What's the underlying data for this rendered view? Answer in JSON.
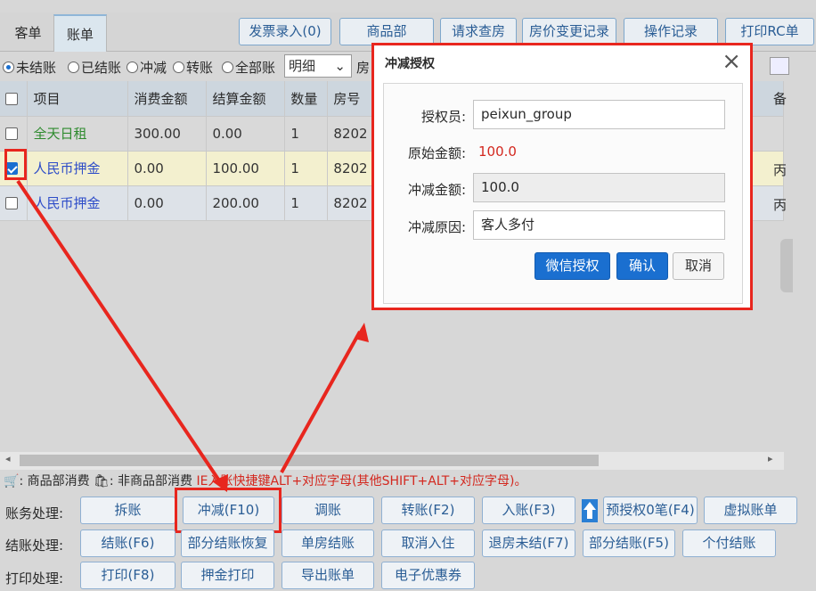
{
  "tabs": [
    {
      "label": "客单"
    },
    {
      "label": "账单"
    }
  ],
  "toolbar": {
    "invoice": "发票录入(0)",
    "goods_dept": "商品部",
    "request_room": "请求查房",
    "price_change": "房价变更记录",
    "op_log": "操作记录",
    "print_rc": "打印RC单"
  },
  "filter": {
    "radios": [
      "未结账",
      "已结账",
      "冲减",
      "转账",
      "全部账"
    ],
    "detail_select": "明细",
    "room_label": "房"
  },
  "table": {
    "headers": [
      "项目",
      "消费金额",
      "结算金额",
      "数量",
      "房号",
      "备"
    ],
    "rows": [
      {
        "item": "全天日租",
        "consume": "300.00",
        "settle": "0.00",
        "qty": "1",
        "room": "8202",
        "extra": ""
      },
      {
        "item": "人民币押金",
        "consume": "0.00",
        "settle": "100.00",
        "qty": "1",
        "room": "8202",
        "extra": "丙"
      },
      {
        "item": "人民币押金",
        "consume": "0.00",
        "settle": "200.00",
        "qty": "1",
        "room": "8202",
        "extra": "丙"
      }
    ]
  },
  "legend": {
    "goods": "商品部消费",
    "non_goods": "非商品部消费",
    "hint": "IE入账快捷键ALT+对应字母(其他SHIFT+ALT+对应字母)。"
  },
  "actions": {
    "account_label": "账务处理:",
    "settle_label": "结账处理:",
    "print_label": "打印处理:",
    "split": "拆账",
    "offset": "冲减(F10)",
    "adjust": "调账",
    "transfer": "转账(F2)",
    "post": "入账(F3)",
    "preauth": "预授权0笔(F4)",
    "virtual": "虚拟账单",
    "checkout": "结账(F6)",
    "partial_restore": "部分结账恢复",
    "single_room": "单房结账",
    "cancel_checkin": "取消入住",
    "checkout_unpaid": "退房未结(F7)",
    "partial_checkout": "部分结账(F5)",
    "individual": "个付结账",
    "print": "打印(F8)",
    "deposit_print": "押金打印",
    "export": "导出账单",
    "coupon": "电子优惠券"
  },
  "dialog": {
    "title": "冲减授权",
    "authorizer_label": "授权员:",
    "authorizer_value": "peixun_group",
    "original_label": "原始金额:",
    "original_value": "100.0",
    "offset_label": "冲减金额:",
    "offset_value": "100.0",
    "reason_label": "冲减原因:",
    "reason_value": "客人多付",
    "wechat_btn": "微信授权",
    "confirm_btn": "确认",
    "cancel_btn": "取消",
    "accent": "#1a6fd0",
    "amount_color": "#d3281f"
  },
  "highlight_color": "#e8261e"
}
